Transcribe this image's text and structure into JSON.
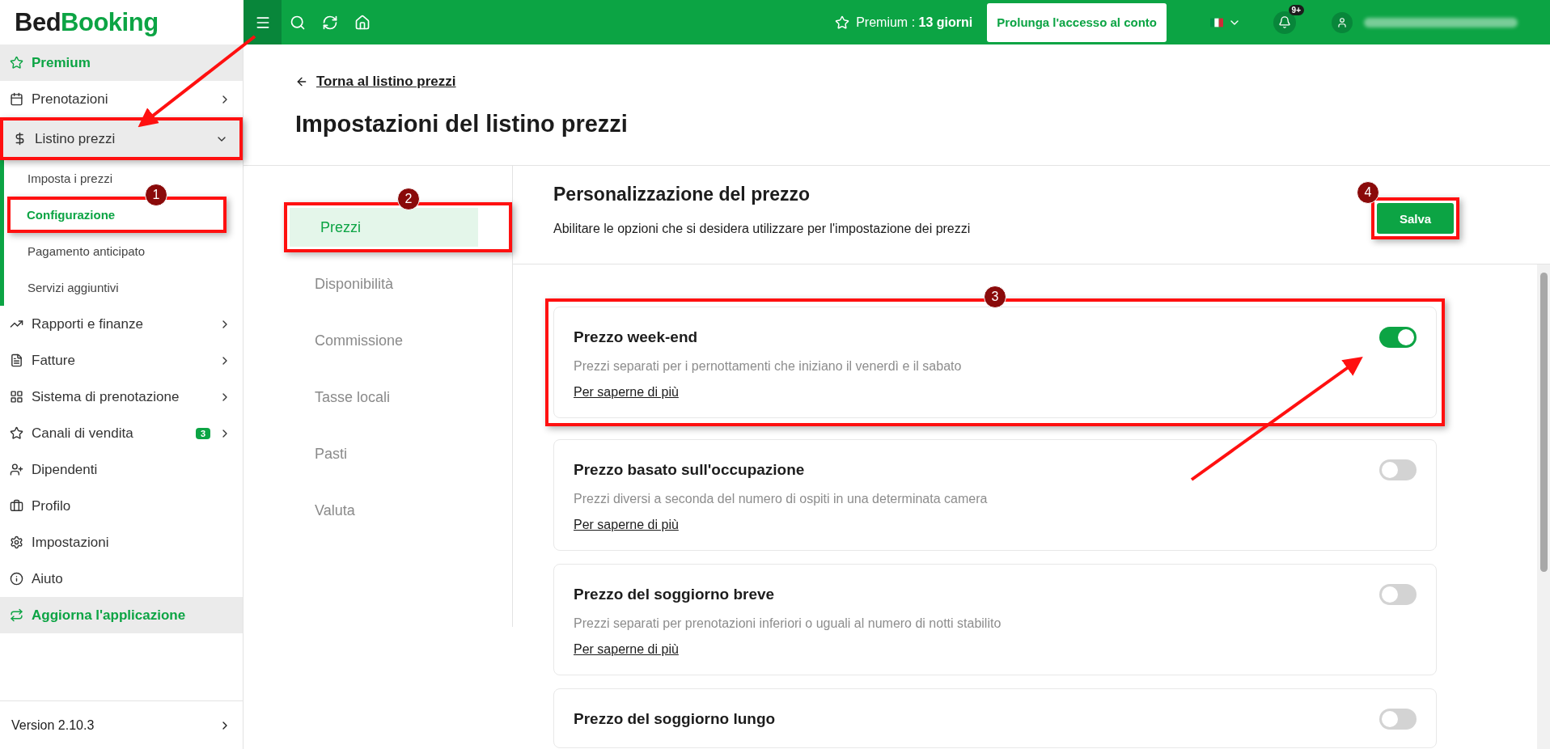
{
  "logo": {
    "part_1": "Bed",
    "part_2": "Booking"
  },
  "topbar": {
    "premium": "Premium : **13 giorni**",
    "extend_button": "Prolunga l'accesso al conto",
    "notifications_badge": "9+"
  },
  "sidebar": {
    "items": [
      {
        "label": "Premium",
        "kind": "accent",
        "has_submenu": false
      },
      {
        "label": "Prenotazioni",
        "kind": "normal",
        "has_submenu": true
      },
      {
        "label": "Listino prezzi",
        "kind": "normal",
        "has_submenu": true,
        "expanded": true,
        "highlighted": true,
        "children": [
          {
            "label": "Imposta i prezzi",
            "selected": false,
            "highlighted": false
          },
          {
            "label": "Configurazione",
            "selected": true,
            "highlighted": true,
            "badge": "1"
          },
          {
            "label": "Pagamento anticipato",
            "selected": false,
            "highlighted": false
          },
          {
            "label": "Servizi aggiuntivi",
            "selected": false,
            "highlighted": false
          }
        ]
      },
      {
        "label": "Rapporti e finanze",
        "kind": "normal",
        "has_submenu": true
      },
      {
        "label": "Fatture",
        "kind": "normal",
        "has_submenu": true
      },
      {
        "label": "Sistema di prenotazione",
        "kind": "normal",
        "has_submenu": true
      },
      {
        "label": "Canali di vendita",
        "kind": "normal",
        "has_submenu": true,
        "count": "3"
      },
      {
        "label": "Dipendenti",
        "kind": "normal",
        "has_submenu": false
      },
      {
        "label": "Profilo",
        "kind": "normal",
        "has_submenu": false
      },
      {
        "label": "Impostazioni",
        "kind": "normal",
        "has_submenu": false
      },
      {
        "label": "Aiuto",
        "kind": "normal",
        "has_submenu": false
      },
      {
        "label": "Aggiorna l'applicazione",
        "kind": "accent",
        "has_submenu": false
      }
    ],
    "version": "Version 2.10.3"
  },
  "page": {
    "back_link": "Torna al listino prezzi",
    "title": "Impostazioni del listino prezzi"
  },
  "tabs": [
    {
      "label": "Prezzi",
      "selected": true,
      "highlighted": true,
      "badge": "2"
    },
    {
      "label": "Disponibilità",
      "selected": false,
      "highlighted": false
    },
    {
      "label": "Commissione",
      "selected": false,
      "highlighted": false
    },
    {
      "label": "Tasse locali",
      "selected": false,
      "highlighted": false
    },
    {
      "label": "Pasti",
      "selected": false,
      "highlighted": false
    },
    {
      "label": "Valuta",
      "selected": false,
      "highlighted": false
    }
  ],
  "section": {
    "title": "Personalizzazione del prezzo",
    "subtitle": "Abilitare le opzioni che si desidera utilizzare per l'impostazione dei prezzi",
    "save_button": {
      "label": "Salva",
      "highlighted": true,
      "badge": "4"
    }
  },
  "options": [
    {
      "title": "Prezzo week-end",
      "description": "Prezzi separati per i pernottamenti che iniziano il venerdì e il sabato",
      "link": "Per saperne di più",
      "on": true,
      "highlighted": true,
      "badge": "3"
    },
    {
      "title": "Prezzo basato sull'occupazione",
      "description": "Prezzi diversi a seconda del numero di ospiti in una determinata camera",
      "link": "Per saperne di più",
      "on": false,
      "highlighted": false
    },
    {
      "title": "Prezzo del soggiorno breve",
      "description": "Prezzi separati per prenotazioni inferiori o uguali al numero di notti stabilito",
      "link": "Per saperne di più",
      "on": false,
      "highlighted": false
    },
    {
      "title": "Prezzo del soggiorno lungo",
      "on": false,
      "highlighted": false
    }
  ]
}
